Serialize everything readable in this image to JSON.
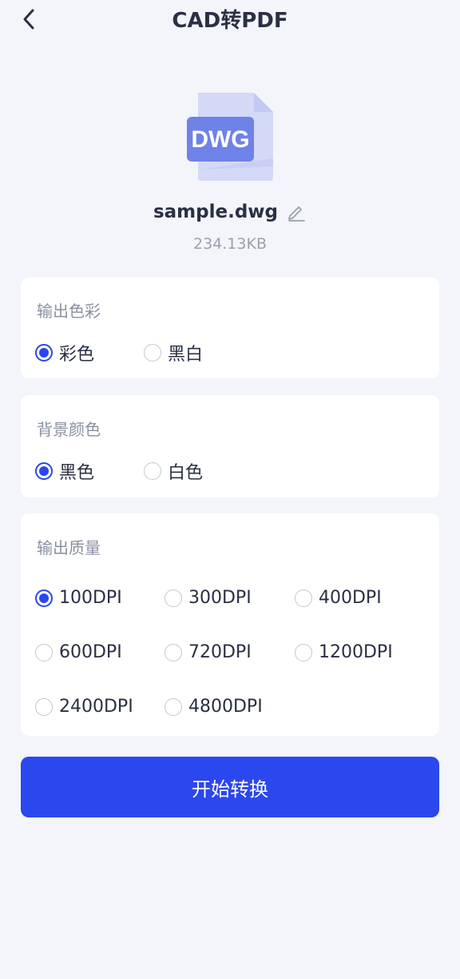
{
  "header": {
    "title": "CAD转PDF",
    "back_icon": "chevron-left-icon"
  },
  "file": {
    "type_label": "DWG",
    "name": "sample.dwg",
    "size": "234.13KB",
    "edit_icon": "pencil-icon"
  },
  "color_output": {
    "title": "输出色彩",
    "options": [
      "彩色",
      "黑白"
    ],
    "selected": "彩色"
  },
  "background": {
    "title": "背景颜色",
    "options": [
      "黑色",
      "白色"
    ],
    "selected": "黑色"
  },
  "quality": {
    "title": "输出质量",
    "options": [
      "100DPI",
      "300DPI",
      "400DPI",
      "600DPI",
      "720DPI",
      "1200DPI",
      "2400DPI",
      "4800DPI"
    ],
    "selected": "100DPI"
  },
  "actions": {
    "start_label": "开始转换"
  },
  "colors": {
    "accent": "#2b47ee",
    "background": "#f3f5fa",
    "file_icon_light": "#d4d9f7",
    "file_icon_dark": "#6f82e8"
  }
}
